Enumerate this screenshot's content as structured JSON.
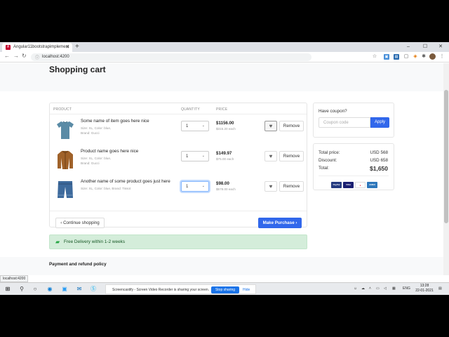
{
  "browser": {
    "tab_title": "Angular11bootstrapimplement",
    "url": "localhost:4200",
    "status_url": "localhost:4200"
  },
  "page": {
    "title": "Shopping cart",
    "columns": {
      "product": "PRODUCT",
      "quantity": "QUANTITY",
      "price": "PRICE"
    },
    "items": [
      {
        "name": "Some name of item goes here nice",
        "meta1": "Size: XL, Color: blue,",
        "meta2": "Brand: Gucci",
        "qty": "1",
        "price": "$1156.00",
        "each": "$315.20 each",
        "image": "tshirt-image",
        "wishlist_active": true,
        "qty_focused": false
      },
      {
        "name": "Product name goes here nice",
        "meta1": "Size: XL, Color: blue,",
        "meta2": "Brand: Gucci",
        "qty": "1",
        "price": "$149.97",
        "each": "$75.00 each",
        "image": "jacket-image",
        "wishlist_active": false,
        "qty_focused": false
      },
      {
        "name": "Another name of some product goes just here",
        "meta1": "Size: XL, Color: blue, Brand: Tissot",
        "meta2": "",
        "qty": "1",
        "price": "$98.00",
        "each": "$578.00 each",
        "image": "jeans-image",
        "wishlist_active": false,
        "qty_focused": true
      }
    ],
    "remove_label": "Remove",
    "continue_label": "Continue shopping",
    "purchase_label": "Make Purchase",
    "delivery_text": "Free Delivery within 1-2 weeks",
    "coupon": {
      "label": "Have coupon?",
      "placeholder": "Coupon code",
      "apply": "Apply"
    },
    "totals": {
      "total_price_label": "Total price:",
      "total_price": "USD 568",
      "discount_label": "Discount:",
      "discount": "USD 658",
      "total_label": "Total:",
      "total": "$1,650"
    },
    "payment_cards": [
      "PayPal",
      "VISA",
      "MC",
      "AMEX"
    ],
    "policy_title": "Payment and refund policy"
  },
  "taskbar": {
    "share_message": "Screencastify - Screen Video Recorder is sharing your screen.",
    "stop_label": "Stop sharing",
    "hide_label": "Hide",
    "lang": "ENG",
    "time": "13:28",
    "date": "22-01-2021"
  },
  "colors": {
    "primary": "#3167eb",
    "success_bg": "#d4edda",
    "success_text": "#155724"
  }
}
